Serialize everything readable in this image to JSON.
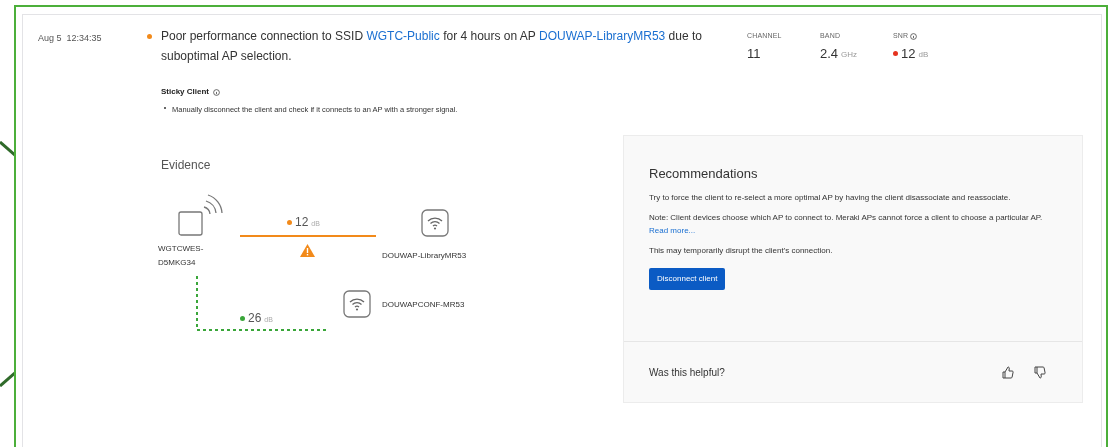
{
  "event": {
    "timestamp": "Aug 5  12:34:35",
    "color": "#f28a1a",
    "message": [
      {
        "kind": "text",
        "text": "Poor performance connection to SSID "
      },
      {
        "kind": "link",
        "text": "WGTC-Public"
      },
      {
        "kind": "text",
        "text": " for 4 hours on AP "
      },
      {
        "kind": "link",
        "text": "DOUWAP-LibraryMR53"
      },
      {
        "kind": "text",
        "text": " due to suboptimal AP selection."
      }
    ]
  },
  "stats": [
    {
      "label": "CHANNEL",
      "value": "11"
    },
    {
      "label": "BAND",
      "value": "2.4",
      "unit": "GHz"
    },
    {
      "label": "SNR",
      "value": "12",
      "unit": "dB",
      "info": true,
      "color": "#e5331f"
    }
  ],
  "cause": {
    "title": "Sticky Client",
    "info": true,
    "bullets": [
      "Manually disconnect the client and check if it connects to an AP with a stronger signal."
    ]
  },
  "evidence": {
    "title": "Evidence",
    "client": "WGTCWES-D5MKG34",
    "links": [
      {
        "kind": "current",
        "snr": "12",
        "unit": "dB",
        "color": "#f28a1a",
        "warning": true,
        "ap": "DOUWAP-LibraryMR53"
      },
      {
        "kind": "alternative",
        "snr": "26",
        "unit": "dB",
        "color": "#3aa63a",
        "ap": "DOUWAPCONF-MR53"
      }
    ]
  },
  "recommendations": {
    "title": "Recommendations",
    "paragraphs": [
      [
        {
          "kind": "text",
          "text": "Try to force the client to re-select a more optimal AP by having the client disassociate and reassociate."
        }
      ],
      [
        {
          "kind": "text",
          "text": "Note: Client devices choose which AP to connect to. Meraki APs cannot force a client to choose a particular AP. "
        },
        {
          "kind": "link",
          "text": "Read more..."
        }
      ],
      [
        {
          "kind": "text",
          "text": "This may temporarily disrupt the client's connection."
        }
      ]
    ],
    "button": "Disconnect client",
    "feedback": "Was this helpful?"
  }
}
